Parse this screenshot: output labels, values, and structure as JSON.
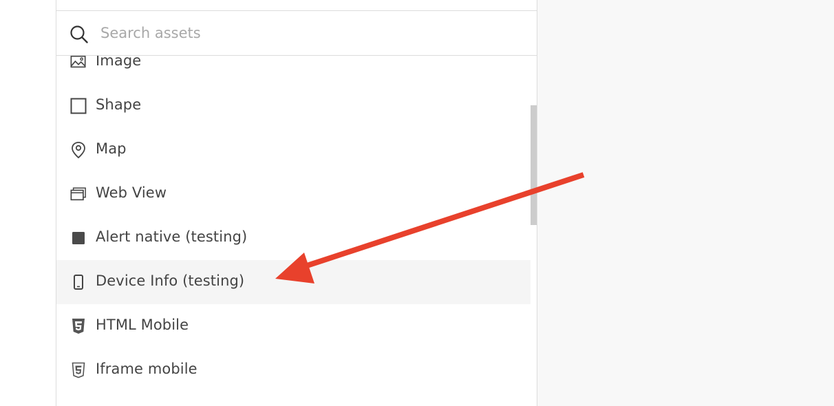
{
  "search": {
    "placeholder": "Search assets",
    "icon": "search-icon"
  },
  "assets": [
    {
      "label": "Image",
      "icon": "image-icon"
    },
    {
      "label": "Shape",
      "icon": "square-icon"
    },
    {
      "label": "Map",
      "icon": "map-pin-icon"
    },
    {
      "label": "Web View",
      "icon": "web-view-icon"
    },
    {
      "label": "Alert native (testing)",
      "icon": "filled-square-icon"
    },
    {
      "label": "Device Info (testing)",
      "icon": "mobile-device-icon",
      "hovered": true
    },
    {
      "label": "HTML Mobile",
      "icon": "html5-icon"
    },
    {
      "label": "Iframe mobile",
      "icon": "html5-outline-icon"
    }
  ],
  "colors": {
    "accent_arrow": "#e8412c",
    "hover_bg": "#f5f5f5",
    "right_area_bg": "#f8f8f8",
    "text": "#444444"
  }
}
